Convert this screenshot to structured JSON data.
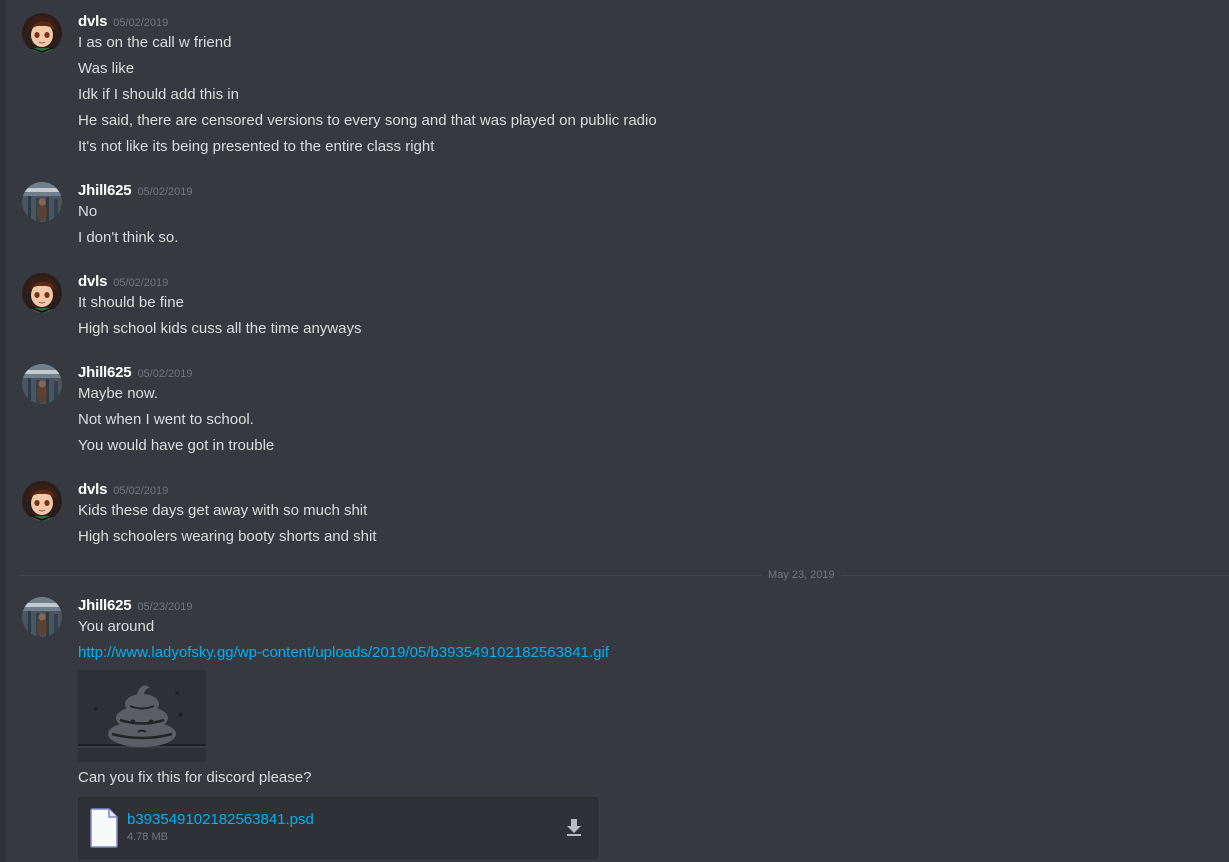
{
  "messages": [
    {
      "user": "dvls",
      "timestamp": "05/02/2019",
      "avatar_icon": "anime-character-avatar",
      "lines": [
        "I as on the call w friend",
        "Was like",
        "Idk if I should add this in",
        "He said, there are censored versions to every song and that was played on public radio",
        "It's not like its being presented to the entire class right"
      ]
    },
    {
      "user": "Jhill625",
      "timestamp": "05/02/2019",
      "avatar_icon": "photo-avatar",
      "lines": [
        "No",
        "I don't think so."
      ]
    },
    {
      "user": "dvls",
      "timestamp": "05/02/2019",
      "avatar_icon": "anime-character-avatar",
      "lines": [
        "It should be fine",
        "High school kids cuss all the time anyways"
      ]
    },
    {
      "user": "Jhill625",
      "timestamp": "05/02/2019",
      "avatar_icon": "photo-avatar",
      "lines": [
        "Maybe now.",
        "Not when I went to school.",
        "You would have got in trouble"
      ]
    },
    {
      "user": "dvls",
      "timestamp": "05/02/2019",
      "avatar_icon": "anime-character-avatar",
      "lines": [
        "Kids these days get away with so much shit",
        "High schoolers wearing booty shorts and shit"
      ]
    },
    {
      "user": "Jhill625",
      "timestamp": "05/23/2019",
      "avatar_icon": "photo-avatar",
      "lines": [
        "You around"
      ],
      "link": "http://www.ladyofsky.gg/wp-content/uploads/2019/05/b393549102182563841.gif",
      "embed_icon": "poop-emoji-image",
      "after_text": "Can you fix this for discord please?",
      "attachment": {
        "filename": "b393549102182563841.psd",
        "size": "4.78 MB",
        "icon": "file-icon",
        "download_icon": "download-icon"
      }
    }
  ],
  "date_divider": "May 23, 2019",
  "colors": {
    "background": "#36393f",
    "username": "#ffffff",
    "text": "#dcddde",
    "timestamp": "#72767d",
    "link": "#00b0f4",
    "divider": "#42454a"
  }
}
